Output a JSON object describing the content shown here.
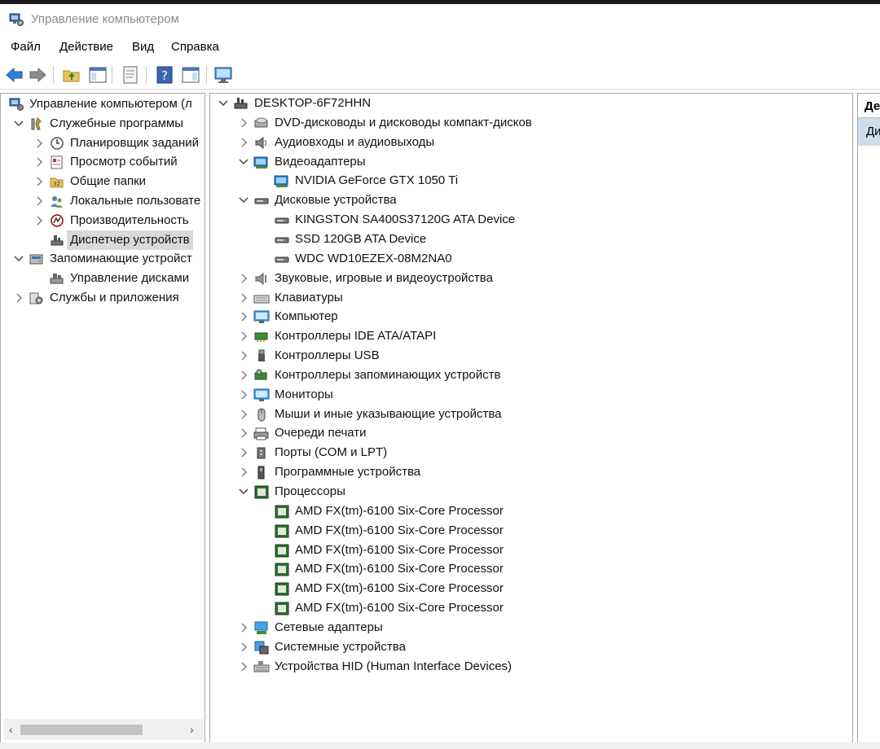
{
  "window": {
    "title": "Управление компьютером"
  },
  "menu": [
    "Файл",
    "Действие",
    "Вид",
    "Справка"
  ],
  "toolbar": [
    "back-icon",
    "forward-icon",
    "up-folder-icon",
    "show-hide-tree-icon",
    "properties-icon",
    "help-icon",
    "action-pane-icon",
    "monitor-icon"
  ],
  "left_tree": [
    {
      "label": "Управление компьютером (л",
      "indent": 0,
      "chev": "none",
      "icon": "computer-mgmt-icon"
    },
    {
      "label": "Служебные программы",
      "indent": 1,
      "chev": "down",
      "icon": "tools-icon"
    },
    {
      "label": "Планировщик заданий",
      "indent": 2,
      "chev": "right",
      "icon": "clock-icon"
    },
    {
      "label": "Просмотр событий",
      "indent": 2,
      "chev": "right",
      "icon": "event-viewer-icon"
    },
    {
      "label": "Общие папки",
      "indent": 2,
      "chev": "right",
      "icon": "shared-folder-icon"
    },
    {
      "label": "Локальные пользовате",
      "indent": 2,
      "chev": "right",
      "icon": "users-icon"
    },
    {
      "label": "Производительность",
      "indent": 2,
      "chev": "right",
      "icon": "performance-icon"
    },
    {
      "label": "Диспетчер устройств",
      "indent": 2,
      "chev": "none",
      "icon": "device-manager-icon",
      "selected": true
    },
    {
      "label": "Запоминающие устройст",
      "indent": 1,
      "chev": "down",
      "icon": "storage-icon"
    },
    {
      "label": "Управление дисками",
      "indent": 2,
      "chev": "none",
      "icon": "disk-mgmt-icon"
    },
    {
      "label": "Службы и приложения",
      "indent": 1,
      "chev": "right",
      "icon": "services-icon"
    }
  ],
  "device_tree": [
    {
      "label": "DESKTOP-6F72HHN",
      "indent": 0,
      "chev": "down",
      "icon": "computer-tree-icon"
    },
    {
      "label": "DVD-дисководы и дисководы компакт-дисков",
      "indent": 1,
      "chev": "right",
      "icon": "dvd-icon"
    },
    {
      "label": "Аудиовходы и аудиовыходы",
      "indent": 1,
      "chev": "right",
      "icon": "speaker-icon"
    },
    {
      "label": "Видеоадаптеры",
      "indent": 1,
      "chev": "down",
      "icon": "display-adapter-icon"
    },
    {
      "label": "NVIDIA GeForce GTX 1050 Ti",
      "indent": 2,
      "chev": "none",
      "icon": "display-adapter-icon"
    },
    {
      "label": "Дисковые устройства",
      "indent": 1,
      "chev": "down",
      "icon": "disk-drive-icon"
    },
    {
      "label": "KINGSTON SA400S37120G ATA Device",
      "indent": 2,
      "chev": "none",
      "icon": "disk-drive-icon"
    },
    {
      "label": "SSD 120GB ATA Device",
      "indent": 2,
      "chev": "none",
      "icon": "disk-drive-icon"
    },
    {
      "label": "WDC WD10EZEX-08M2NA0",
      "indent": 2,
      "chev": "none",
      "icon": "disk-drive-icon"
    },
    {
      "label": "Звуковые, игровые и видеоустройства",
      "indent": 1,
      "chev": "right",
      "icon": "sound-icon"
    },
    {
      "label": "Клавиатуры",
      "indent": 1,
      "chev": "right",
      "icon": "keyboard-icon"
    },
    {
      "label": "Компьютер",
      "indent": 1,
      "chev": "right",
      "icon": "monitor-icon"
    },
    {
      "label": "Контроллеры IDE ATA/ATAPI",
      "indent": 1,
      "chev": "right",
      "icon": "controller-icon"
    },
    {
      "label": "Контроллеры USB",
      "indent": 1,
      "chev": "right",
      "icon": "usb-icon"
    },
    {
      "label": "Контроллеры запоминающих устройств",
      "indent": 1,
      "chev": "right",
      "icon": "storage-controller-icon"
    },
    {
      "label": "Мониторы",
      "indent": 1,
      "chev": "right",
      "icon": "monitor-icon"
    },
    {
      "label": "Мыши и иные указывающие устройства",
      "indent": 1,
      "chev": "right",
      "icon": "mouse-icon"
    },
    {
      "label": "Очереди печати",
      "indent": 1,
      "chev": "right",
      "icon": "printer-icon"
    },
    {
      "label": "Порты (COM и LPT)",
      "indent": 1,
      "chev": "right",
      "icon": "port-icon"
    },
    {
      "label": "Программные устройства",
      "indent": 1,
      "chev": "right",
      "icon": "software-device-icon"
    },
    {
      "label": "Процессоры",
      "indent": 1,
      "chev": "down",
      "icon": "processor-icon"
    },
    {
      "label": "AMD FX(tm)-6100 Six-Core Processor",
      "indent": 2,
      "chev": "none",
      "icon": "processor-icon"
    },
    {
      "label": "AMD FX(tm)-6100 Six-Core Processor",
      "indent": 2,
      "chev": "none",
      "icon": "processor-icon"
    },
    {
      "label": "AMD FX(tm)-6100 Six-Core Processor",
      "indent": 2,
      "chev": "none",
      "icon": "processor-icon"
    },
    {
      "label": "AMD FX(tm)-6100 Six-Core Processor",
      "indent": 2,
      "chev": "none",
      "icon": "processor-icon"
    },
    {
      "label": "AMD FX(tm)-6100 Six-Core Processor",
      "indent": 2,
      "chev": "none",
      "icon": "processor-icon"
    },
    {
      "label": "AMD FX(tm)-6100 Six-Core Processor",
      "indent": 2,
      "chev": "none",
      "icon": "processor-icon"
    },
    {
      "label": "Сетевые адаптеры",
      "indent": 1,
      "chev": "right",
      "icon": "network-icon"
    },
    {
      "label": "Системные устройства",
      "indent": 1,
      "chev": "right",
      "icon": "system-device-icon"
    },
    {
      "label": "Устройства HID (Human Interface Devices)",
      "indent": 1,
      "chev": "right",
      "icon": "hid-icon"
    }
  ],
  "actions_pane": {
    "header": "Де",
    "item": "Ди"
  }
}
